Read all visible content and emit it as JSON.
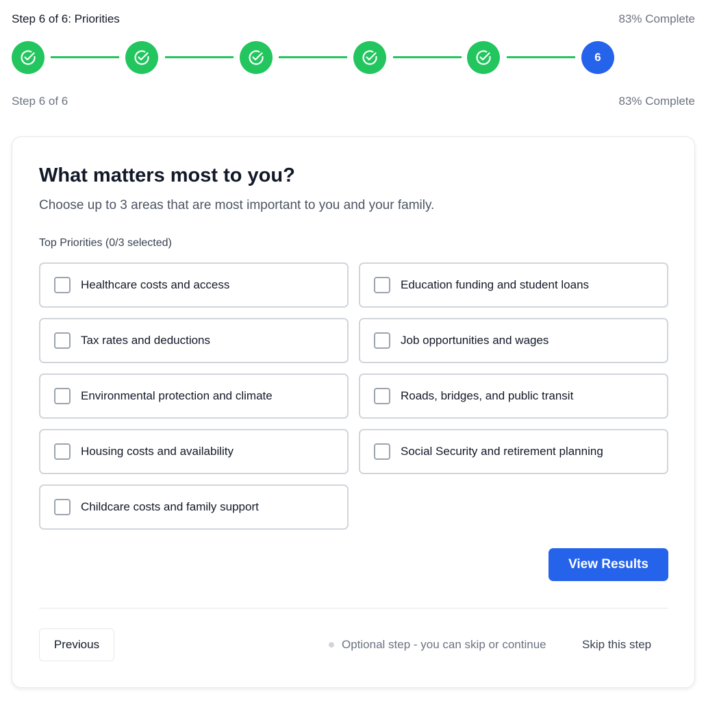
{
  "header": {
    "step_title": "Step 6 of 6: Priorities",
    "percent_complete": "83% Complete"
  },
  "stepper": {
    "steps": [
      {
        "state": "done",
        "icon": "check-circle-icon"
      },
      {
        "state": "done",
        "icon": "check-circle-icon"
      },
      {
        "state": "done",
        "icon": "check-circle-icon"
      },
      {
        "state": "done",
        "icon": "check-circle-icon"
      },
      {
        "state": "done",
        "icon": "check-circle-icon"
      },
      {
        "state": "current",
        "label": "6"
      }
    ],
    "colors": {
      "done": "#22c55e",
      "current": "#2563eb"
    }
  },
  "progress": {
    "step_text": "Step 6 of 6",
    "percent_text": "83% Complete"
  },
  "card": {
    "title": "What matters most to you?",
    "description": "Choose up to 3 areas that are most important to you and your family.",
    "group_label": "Top Priorities (0/3 selected)",
    "options": [
      {
        "label": "Healthcare costs and access",
        "checked": false
      },
      {
        "label": "Education funding and student loans",
        "checked": false
      },
      {
        "label": "Tax rates and deductions",
        "checked": false
      },
      {
        "label": "Job opportunities and wages",
        "checked": false
      },
      {
        "label": "Environmental protection and climate",
        "checked": false
      },
      {
        "label": "Roads, bridges, and public transit",
        "checked": false
      },
      {
        "label": "Housing costs and availability",
        "checked": false
      },
      {
        "label": "Social Security and retirement planning",
        "checked": false
      },
      {
        "label": "Childcare costs and family support",
        "checked": false
      }
    ],
    "view_results_label": "View Results"
  },
  "footer": {
    "previous_label": "Previous",
    "optional_text": "Optional step - you can skip or continue",
    "skip_label": "Skip this step"
  },
  "colors": {
    "primary": "#2563eb",
    "success": "#22c55e",
    "muted_text": "#6b7280"
  }
}
